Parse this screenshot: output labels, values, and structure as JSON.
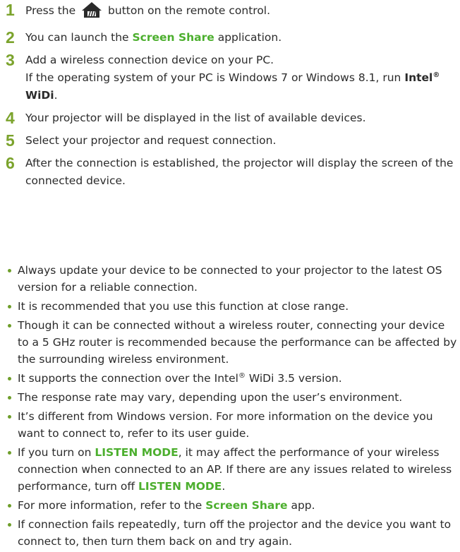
{
  "steps": [
    {
      "num": "1",
      "pre": "Press the",
      "post": "button on the remote control."
    },
    {
      "num": "2",
      "pre": "You can launch the",
      "hl": "Screen Share",
      "post": "application."
    },
    {
      "num": "3",
      "line1": "Add a wireless connection device on your PC.",
      "line2_pre": "If the operating system of your PC is Windows 7 or Windows 8.1, run",
      "bold1": "Intel",
      "reg": "®",
      "bold2": "WiDi",
      "line2_post": "."
    },
    {
      "num": "4",
      "text": "Your projector will be displayed in the list of available devices."
    },
    {
      "num": "5",
      "text": "Select your projector and request connection."
    },
    {
      "num": "6",
      "text": "After the connection is established, the projector will display the screen of the connected device."
    }
  ],
  "notes": {
    "n1": "Always update your device to be connected to your projector to the latest OS version for a reliable connection.",
    "n2": "It is recommended that you use this function at close range.",
    "n3": "Though it can be connected without a wireless router, connecting your device to a 5 GHz router is recommended because the performance can be affected by the surrounding wireless environment.",
    "n4_a": "It supports the connection over the Intel",
    "n4_reg": "®",
    "n4_b": "WiDi 3.5 version.",
    "n5": "The response rate may vary, depending upon the user’s environment.",
    "n6": "It’s different from Windows version. For more information on the device you want to connect to, refer to its user guide.",
    "n7_a": "If you turn on",
    "n7_hl1": "LISTEN MODE",
    "n7_b": ", it may affect the performance of your wireless connection when connected to an AP. If there are any issues related to wireless performance, turn off",
    "n7_hl2": "LISTEN MODE",
    "n7_c": ".",
    "n8_a": "For more information, refer to the",
    "n8_hl": "Screen Share",
    "n8_b": "app.",
    "n9": "If connection fails repeatedly, turn off the projector and the device you want to connect to, then turn them back on and try again."
  },
  "colors": {
    "step_number": "#7ba32c",
    "highlight": "#4caf2e",
    "bullet": "#6e9e2a"
  },
  "icons": {
    "home": "home-icon"
  }
}
